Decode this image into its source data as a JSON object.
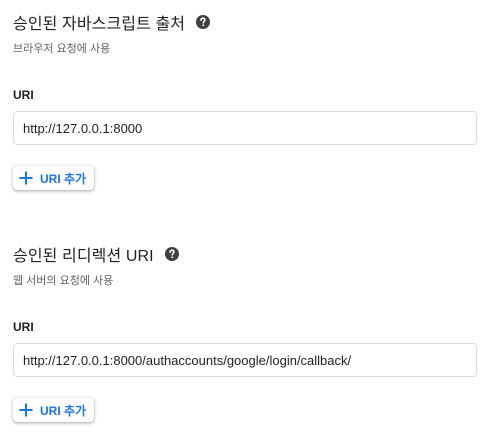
{
  "js_origins": {
    "title": "승인된 자바스크립트 출처",
    "subtitle": "브라우저 요청에 사용",
    "field_label": "URI",
    "uri_value": "http://127.0.0.1:8000",
    "add_button_label": "URI 추가"
  },
  "redirect_uris": {
    "title": "승인된 리디렉션 URI",
    "subtitle": "웹 서버의 요청에 사용",
    "field_label": "URI",
    "uri_value": "http://127.0.0.1:8000/authaccounts/google/login/callback/",
    "add_button_label": "URI 추가"
  },
  "icons": {
    "help": "help-circle-icon",
    "add": "plus-icon"
  },
  "colors": {
    "accent": "#1a73e8",
    "text_primary": "#202124",
    "text_secondary": "#5f6368",
    "border": "#dadce0",
    "help_icon": "#3c4043"
  }
}
